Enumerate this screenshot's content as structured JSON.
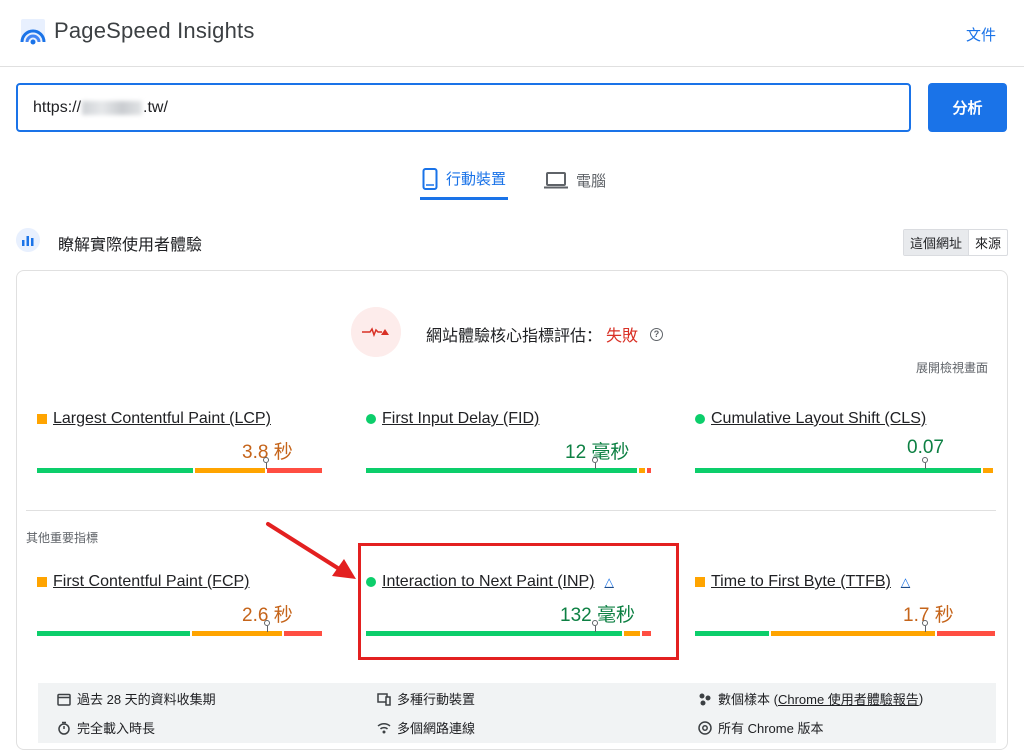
{
  "header": {
    "title": "PageSpeed Insights",
    "docs_link": "文件"
  },
  "search": {
    "url_prefix": "https://",
    "url_suffix": ".tw/",
    "analyze_label": "分析"
  },
  "tabs": [
    {
      "label": "行動裝置"
    },
    {
      "label": "電腦"
    }
  ],
  "section": {
    "title": "瞭解實際使用者體驗",
    "toggle": {
      "this_url": "這個網址",
      "origin": "來源"
    }
  },
  "assessment": {
    "label": "網站體驗核心指標評估：",
    "result": "失敗",
    "help": "?",
    "expand": "展開檢視畫面"
  },
  "core_metrics": [
    {
      "name": "Largest Contentful Paint (LCP)",
      "value": "3.8 秒",
      "status": "needs-improvement",
      "color": "#ffa400",
      "distribution": {
        "good": 0.55,
        "needs_improvement": 0.25,
        "poor": 0.2
      }
    },
    {
      "name": "First Input Delay (FID)",
      "value": "12 毫秒",
      "status": "good",
      "color": "#0cce6b",
      "distribution": {
        "good": 0.95,
        "needs_improvement": 0.03,
        "poor": 0.02
      }
    },
    {
      "name": "Cumulative Layout Shift (CLS)",
      "value": "0.07",
      "status": "good",
      "color": "#0cce6b",
      "distribution": {
        "good": 0.96,
        "needs_improvement": 0.04,
        "poor": 0.0
      }
    }
  ],
  "other_label": "其他重要指標",
  "other_metrics": [
    {
      "name": "First Contentful Paint (FCP)",
      "value": "2.6 秒",
      "status": "needs-improvement",
      "color": "#ffa400",
      "distribution": {
        "good": 0.54,
        "needs_improvement": 0.32,
        "poor": 0.14
      },
      "experimental": false
    },
    {
      "name": "Interaction to Next Paint (INP)",
      "value": "132 毫秒",
      "status": "good",
      "color": "#0cce6b",
      "distribution": {
        "good": 0.9,
        "needs_improvement": 0.06,
        "poor": 0.04
      },
      "experimental": true
    },
    {
      "name": "Time to First Byte (TTFB)",
      "value": "1.7 秒",
      "status": "needs-improvement",
      "color": "#ffa400",
      "distribution": {
        "good": 0.25,
        "needs_improvement": 0.55,
        "poor": 0.2
      },
      "experimental": true
    }
  ],
  "footer": {
    "items": [
      {
        "icon": "calendar-icon",
        "text": "過去 28 天的資料收集期"
      },
      {
        "icon": "devices-icon",
        "text": "多種行動裝置"
      },
      {
        "icon": "samples-icon",
        "text": "數個樣本 (",
        "link": "Chrome 使用者體驗報告",
        "suffix": ")"
      },
      {
        "icon": "timer-icon",
        "text": "完全載入時長"
      },
      {
        "icon": "wifi-icon",
        "text": "多個網路連線"
      },
      {
        "icon": "chrome-icon",
        "text": "所有 Chrome 版本"
      }
    ]
  },
  "colors": {
    "good": "#0cce6b",
    "needs_improvement": "#ffa400",
    "poor": "#ff4e42",
    "accent": "#1a73e8",
    "fail": "#d93025",
    "annotation": "#e32020"
  }
}
